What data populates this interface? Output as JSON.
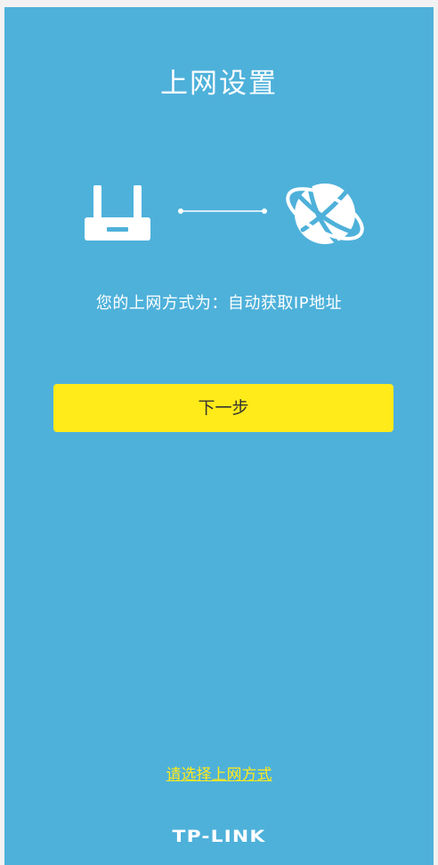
{
  "page": {
    "title": "上网设置",
    "method_text": "您的上网方式为：自动获取IP地址",
    "next_button_label": "下一步",
    "select_method_link": "请选择上网方式",
    "brand": "TP-LINK"
  },
  "icons": {
    "router": "router-icon",
    "connection": "connection-line-icon",
    "internet": "globe-icon"
  },
  "colors": {
    "background": "#4eb1da",
    "button": "#ffea1a",
    "link": "#ffea1a",
    "text": "#ffffff"
  }
}
